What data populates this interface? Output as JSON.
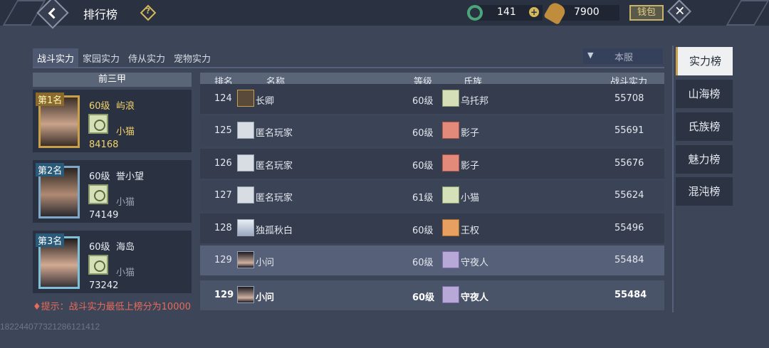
{
  "header": {
    "title": "排行榜",
    "jade_amount": "141",
    "gold_amount": "7900",
    "bag_label": "钱包"
  },
  "subtabs": [
    "战斗实力",
    "家园实力",
    "侍从实力",
    "宠物实力"
  ],
  "server_select": "本服",
  "top3": {
    "header": "前三甲",
    "cards": [
      {
        "rank": "第1名",
        "level": "60级",
        "name": "屿浪",
        "clan": "小猫",
        "power": "84168"
      },
      {
        "rank": "第2名",
        "level": "60级",
        "name": "誉小望",
        "clan": "小猫",
        "power": "74149"
      },
      {
        "rank": "第3名",
        "level": "60级",
        "name": "海岛",
        "clan": "小猫",
        "power": "73242"
      }
    ],
    "hint": "提示：战斗实力最低上榜分为10000"
  },
  "table": {
    "columns": [
      "排名",
      "名称",
      "等级",
      "氏族",
      "战斗实力"
    ],
    "rows": [
      {
        "rank": "124",
        "name": "长卿",
        "level": "60级",
        "clan": "乌托邦",
        "power": "55708"
      },
      {
        "rank": "125",
        "name": "匿名玩家",
        "level": "60级",
        "clan": "影子",
        "power": "55691"
      },
      {
        "rank": "126",
        "name": "匿名玩家",
        "level": "60级",
        "clan": "影子",
        "power": "55676"
      },
      {
        "rank": "127",
        "name": "匿名玩家",
        "level": "61级",
        "clan": "小猫",
        "power": "55624"
      },
      {
        "rank": "128",
        "name": "独孤秋白",
        "level": "60级",
        "clan": "王权",
        "power": "55496"
      },
      {
        "rank": "129",
        "name": "小问",
        "level": "60级",
        "clan": "守夜人",
        "power": "55484"
      }
    ],
    "self_row": {
      "rank": "129",
      "name": "小问",
      "level": "60级",
      "clan": "守夜人",
      "power": "55484"
    }
  },
  "side_tabs": [
    "实力榜",
    "山海榜",
    "氏族榜",
    "魅力榜",
    "混沌榜"
  ],
  "uid": "18224407732128612141​2",
  "colors": {
    "gold": "#f2d36a",
    "hint_red": "#e86a5a",
    "active_tab": "#eef0f2"
  }
}
